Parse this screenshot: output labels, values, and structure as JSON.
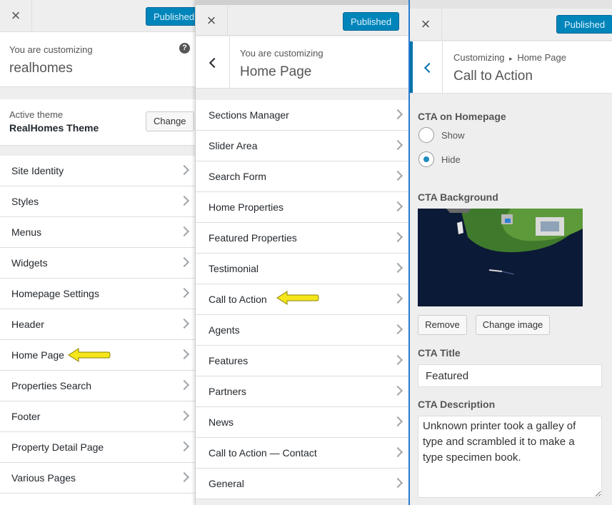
{
  "panel1": {
    "close_label": "×",
    "publish_label": "Published",
    "customizing_label": "You are customizing",
    "site_name": "realhomes",
    "help_icon": "?",
    "active_theme_label": "Active theme",
    "theme_name": "RealHomes Theme",
    "change_label": "Change",
    "items": [
      {
        "label": "Site Identity"
      },
      {
        "label": "Styles"
      },
      {
        "label": "Menus"
      },
      {
        "label": "Widgets"
      },
      {
        "label": "Homepage Settings"
      },
      {
        "label": "Header"
      },
      {
        "label": "Home Page"
      },
      {
        "label": "Properties Search"
      },
      {
        "label": "Footer"
      },
      {
        "label": "Property Detail Page"
      },
      {
        "label": "Various Pages"
      }
    ]
  },
  "panel2": {
    "close_label": "×",
    "publish_label": "Published",
    "customizing_label": "You are customizing",
    "section_title": "Home Page",
    "items": [
      {
        "label": "Sections Manager"
      },
      {
        "label": "Slider Area"
      },
      {
        "label": "Search Form"
      },
      {
        "label": "Home Properties"
      },
      {
        "label": "Featured Properties"
      },
      {
        "label": "Testimonial"
      },
      {
        "label": "Call to Action"
      },
      {
        "label": "Agents"
      },
      {
        "label": "Features"
      },
      {
        "label": "Partners"
      },
      {
        "label": "News"
      },
      {
        "label": "Call to Action — Contact"
      },
      {
        "label": "General"
      }
    ]
  },
  "panel3": {
    "close_label": "×",
    "publish_label": "Published",
    "breadcrumb_root": "Customizing",
    "breadcrumb_sep": "▸",
    "breadcrumb_parent": "Home Page",
    "section_title": "Call to Action",
    "cta_homepage_label": "CTA on Homepage",
    "option_show": "Show",
    "option_hide": "Hide",
    "selected_option": "Hide",
    "cta_background_label": "CTA Background",
    "remove_label": "Remove",
    "change_image_label": "Change image",
    "cta_title_label": "CTA Title",
    "cta_title_value": "Featured",
    "cta_description_label": "CTA Description",
    "cta_description_value": "Unknown printer took a galley of type and scrambled it to make a type specimen book."
  },
  "colors": {
    "accent": "#0085ba",
    "highlight_arrow": "#f5e51b",
    "panel_bg": "#eeeeee",
    "focus_border": "#2a7ad0"
  }
}
